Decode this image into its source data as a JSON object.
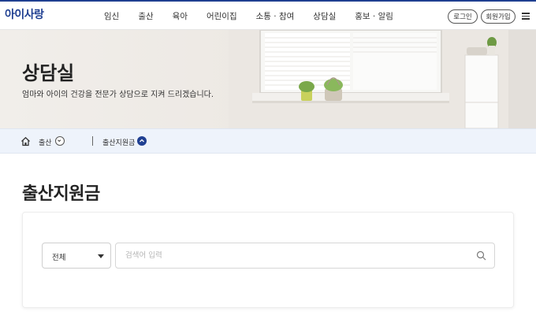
{
  "header": {
    "logo": "아이사랑",
    "nav": [
      "임신",
      "출산",
      "육아",
      "어린이집",
      "소통 · 참여",
      "상담실",
      "홍보 · 알림"
    ],
    "login_label": "로그인",
    "join_label": "회원가입"
  },
  "hero": {
    "title": "상담실",
    "subtitle": "엄마와 아이의 건강을 전문가 상담으로 지켜 드리겠습니다."
  },
  "breadcrumb": {
    "items": [
      "출산",
      "출산지원금"
    ]
  },
  "page": {
    "title": "출산지원금"
  },
  "search": {
    "select_value": "전체",
    "placeholder": "검색어 입력"
  },
  "colors": {
    "brand": "#1f3f91",
    "breadcrumb_bg": "#eef3fb",
    "hero_bg": "#ede9e4"
  }
}
